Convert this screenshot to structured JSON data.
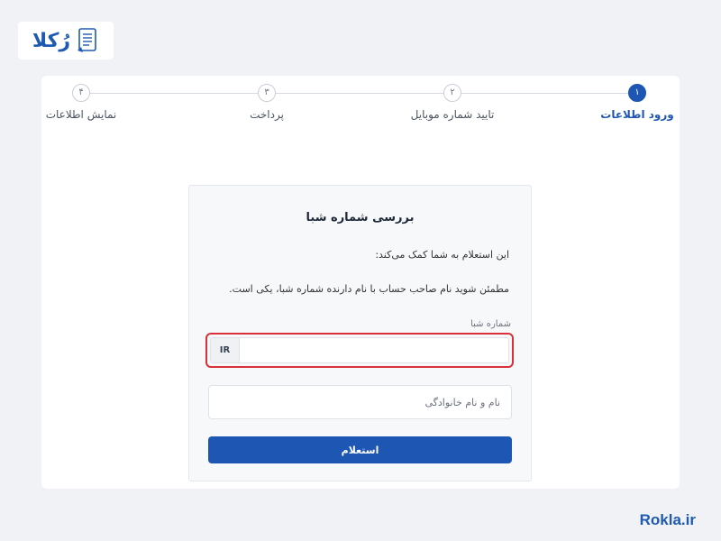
{
  "brand": {
    "logo_text": "رُکلا",
    "logo_icon": "document-icon",
    "watermark": "Rokla.ir",
    "accent_color": "#1e56b3"
  },
  "stepper": {
    "steps": [
      {
        "number": "۱",
        "label": "ورود اطلاعات",
        "active": true
      },
      {
        "number": "۲",
        "label": "تایید شماره موبایل",
        "active": false
      },
      {
        "number": "۳",
        "label": "پرداخت",
        "active": false
      },
      {
        "number": "۴",
        "label": "نمایش اطلاعات",
        "active": false
      }
    ]
  },
  "form": {
    "title": "بررسی شماره شبا",
    "description_1": "این استعلام به شما کمک می‌کند:",
    "description_2": "مطمئن شوید نام صاحب حساب با نام دارنده شماره شبا، یکی است.",
    "sheba_label": "شماره شبا",
    "sheba_prefix": "IR",
    "sheba_value": "",
    "name_placeholder": "نام و نام خانوادگی",
    "name_value": "",
    "submit_label": "استعلام",
    "highlight_color": "#d9303a"
  }
}
